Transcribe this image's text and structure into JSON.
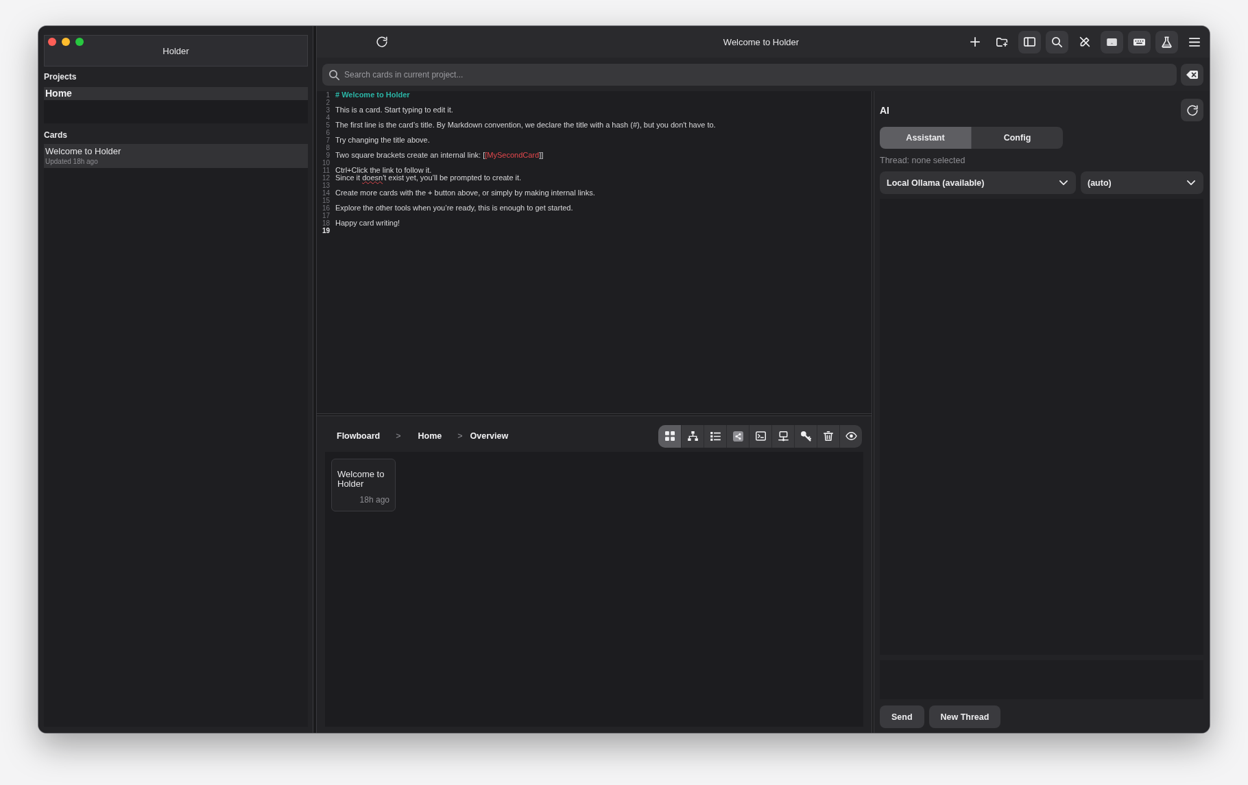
{
  "sidebar": {
    "title": "Holder",
    "projects_heading": "Projects",
    "projects": [
      {
        "name": "Home",
        "selected": true
      }
    ],
    "cards_heading": "Cards",
    "cards": [
      {
        "title": "Welcome to Holder",
        "updated": "Updated 18h ago",
        "selected": true
      }
    ]
  },
  "toolbar": {
    "title": "Welcome to Holder",
    "buttons": [
      {
        "on": false
      },
      {
        "on": false
      },
      {
        "on": true
      },
      {
        "on": true
      },
      {
        "on": false
      },
      {
        "on": true
      },
      {
        "on": true
      },
      {
        "on": true
      },
      {
        "on": false
      }
    ]
  },
  "search": {
    "placeholder": "Search cards in current project..."
  },
  "editor": {
    "lines": [
      {
        "number": "1",
        "current": false,
        "kind": "heading",
        "segments": [
          {
            "kind": "plain",
            "text": "# Welcome to Holder"
          }
        ]
      },
      {
        "number": "2",
        "current": false,
        "kind": "text"
      },
      {
        "number": "3",
        "current": false,
        "kind": "text",
        "segments": [
          {
            "kind": "plain",
            "text": "This is a card. Start typing to edit it."
          }
        ]
      },
      {
        "number": "4",
        "current": false,
        "kind": "text"
      },
      {
        "number": "5",
        "current": false,
        "kind": "text",
        "segments": [
          {
            "kind": "plain",
            "text": "The first line is the card’s title. By Markdown convention, we declare the title with a hash (#), but you don't have to."
          }
        ]
      },
      {
        "number": "6",
        "current": false,
        "kind": "text"
      },
      {
        "number": "7",
        "current": false,
        "kind": "text",
        "segments": [
          {
            "kind": "plain",
            "text": "Try changing the title above."
          }
        ]
      },
      {
        "number": "8",
        "current": false,
        "kind": "text"
      },
      {
        "number": "9",
        "current": false,
        "kind": "text",
        "segments": [
          {
            "kind": "plain",
            "text": "Two square brackets create an internal link: ["
          },
          {
            "kind": "link",
            "text": "[MySecondCard"
          },
          {
            "kind": "plain",
            "text": "]]"
          }
        ]
      },
      {
        "number": "10",
        "current": false,
        "kind": "text"
      },
      {
        "number": "11",
        "current": false,
        "kind": "text",
        "segments": [
          {
            "kind": "plain",
            "text": "Ctrl+Click the link to follow it."
          }
        ]
      },
      {
        "number": "12",
        "current": false,
        "kind": "text",
        "segments": [
          {
            "kind": "plain",
            "text": "Since it "
          },
          {
            "kind": "misspelled",
            "text": "doesn"
          },
          {
            "kind": "plain",
            "text": "'t exist yet, you’ll be prompted to create it."
          }
        ]
      },
      {
        "number": "13",
        "current": false,
        "kind": "text"
      },
      {
        "number": "14",
        "current": false,
        "kind": "text",
        "segments": [
          {
            "kind": "plain",
            "text": "Create more cards with the + button above, or simply by making internal links."
          }
        ]
      },
      {
        "number": "15",
        "current": false,
        "kind": "text"
      },
      {
        "number": "16",
        "current": false,
        "kind": "text",
        "segments": [
          {
            "kind": "plain",
            "text": "Explore the other tools when you’re ready, this is enough to get started."
          }
        ]
      },
      {
        "number": "17",
        "current": false,
        "kind": "text"
      },
      {
        "number": "18",
        "current": false,
        "kind": "text",
        "segments": [
          {
            "kind": "plain",
            "text": "Happy card writing!"
          }
        ]
      },
      {
        "number": "19",
        "current": true,
        "kind": "text"
      }
    ]
  },
  "flowboard": {
    "breadcrumb": [
      {
        "label": "Flowboard"
      },
      {
        "separator": ">",
        "label": "Home"
      },
      {
        "separator": ">",
        "label": "Overview"
      }
    ],
    "views": [
      {
        "selected": true
      },
      {
        "selected": false
      },
      {
        "selected": false
      },
      {
        "selected": false
      },
      {
        "selected": false
      },
      {
        "selected": false
      },
      {
        "selected": false
      },
      {
        "selected": false
      },
      {
        "selected": false
      }
    ],
    "cards": [
      {
        "title": "Welcome to Holder",
        "age": "18h ago"
      }
    ]
  },
  "ai": {
    "title": "AI",
    "tabs": [
      {
        "label": "Assistant",
        "selected": true
      },
      {
        "label": "Config",
        "selected": false
      }
    ],
    "thread": "Thread: none selected",
    "selects": [
      {
        "value": "Local Ollama (available)"
      },
      {
        "value": "(auto)"
      }
    ],
    "buttons": [
      {
        "label": "Send"
      },
      {
        "label": "New Thread"
      }
    ]
  }
}
